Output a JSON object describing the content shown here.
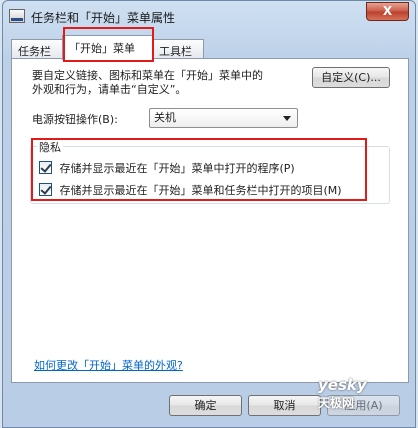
{
  "window": {
    "title": "任务栏和「开始」菜单属性",
    "close_label": "X"
  },
  "tabs": [
    {
      "label": "任务栏"
    },
    {
      "label": "「开始」菜单"
    },
    {
      "label": "工具栏"
    }
  ],
  "start_menu": {
    "description_line1": "要自定义链接、图标和菜单在「开始」菜单中的",
    "description_line2": "外观和行为，请单击“自定义”。",
    "customize_button": "自定义(C)...",
    "power_button_label": "电源按钮操作(B):",
    "power_button_value": "关机"
  },
  "privacy": {
    "legend": "隐私",
    "items": [
      {
        "label": "存储并显示最近在「开始」菜单中打开的程序(P)",
        "checked": true
      },
      {
        "label": "存储并显示最近在「开始」菜单和任务栏中打开的项目(M)",
        "checked": true
      }
    ]
  },
  "help_link": "如何更改「开始」菜单的外观?",
  "buttons": {
    "ok": "确定",
    "cancel": "取消",
    "apply": "应用(A)"
  },
  "watermark": {
    "top": "yesky",
    "bottom": "天极网"
  }
}
